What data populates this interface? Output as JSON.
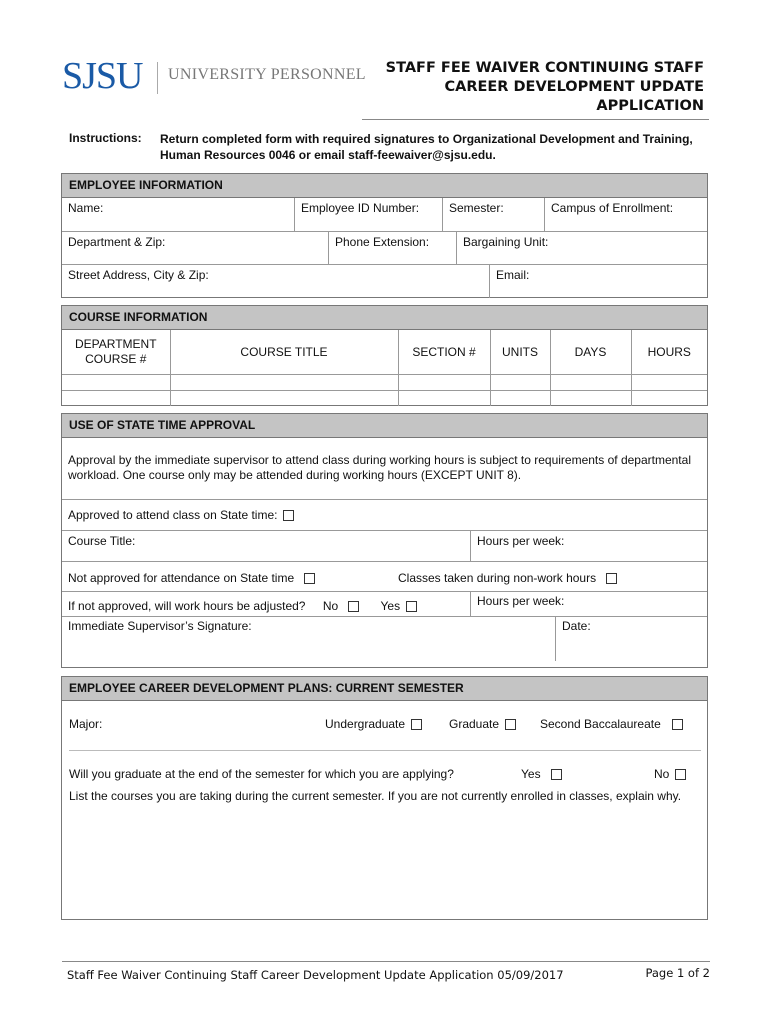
{
  "header": {
    "logo_sjsu": "SJSU",
    "logo_unit": "UNIVERSITY PERSONNEL",
    "title_lines": [
      "STAFF FEE WAIVER CONTINUING STAFF",
      "CAREER DEVELOPMENT UPDATE",
      "APPLICATION"
    ]
  },
  "instructions": {
    "label": "Instructions:",
    "text": "Return completed form with required signatures to Organizational Development and Training, Human Resources 0046 or email staff-feewaiver@sjsu.edu."
  },
  "employee_info": {
    "header": "EMPLOYEE INFORMATION",
    "fields": {
      "name": "Name:",
      "employee_id": "Employee ID Number:",
      "semester": "Semester:",
      "campus": "Campus of Enrollment:",
      "department": "Department & Zip:",
      "phone": "Phone Extension:",
      "bargaining": "Bargaining Unit:",
      "address": "Street Address, City & Zip:",
      "email": "Email:"
    }
  },
  "course_info": {
    "header": "COURSE INFORMATION",
    "columns": [
      "DEPARTMENT COURSE #",
      "COURSE TITLE",
      "SECTION #",
      "UNITS",
      "DAYS",
      "HOURS"
    ],
    "rows": [
      [
        "",
        "",
        "",
        "",
        "",
        ""
      ],
      [
        "",
        "",
        "",
        "",
        "",
        ""
      ]
    ]
  },
  "state_time": {
    "header": "USE OF STATE TIME APPROVAL",
    "description": "Approval by the immediate supervisor to attend class during working hours is subject to requirements of departmental workload. One course only may be attended during working hours (EXCEPT UNIT 8).",
    "approved": "Approved to attend class on State time:",
    "course_title": "Course Title:",
    "hours_per_week": "Hours per week:",
    "not_approved": "Not approved for attendance on State time",
    "non_work_hours": "Classes taken during non-work hours",
    "adjusted_q": "If not approved, will work hours be adjusted?",
    "no": "No",
    "yes": "Yes",
    "hours_per_week_2": "Hours per week:",
    "supervisor_sig": "Immediate Supervisor’s Signature:",
    "date": "Date:"
  },
  "career_plans": {
    "header": "EMPLOYEE CAREER DEVELOPMENT PLANS: CURRENT SEMESTER",
    "major": "Major:",
    "undergraduate": "Undergraduate",
    "graduate": "Graduate",
    "second_bacc": "Second Baccalaureate",
    "graduate_q": "Will you graduate at the end of the semester for which you are applying?",
    "yes": "Yes",
    "no": "No",
    "list_courses": "List the courses you are taking during the current semester. If you are not currently enrolled in classes, explain why."
  },
  "footer": {
    "text": "Staff Fee Waiver Continuing Staff Career Development Update Application 05/09/2017",
    "page": "Page 1 of 2"
  }
}
